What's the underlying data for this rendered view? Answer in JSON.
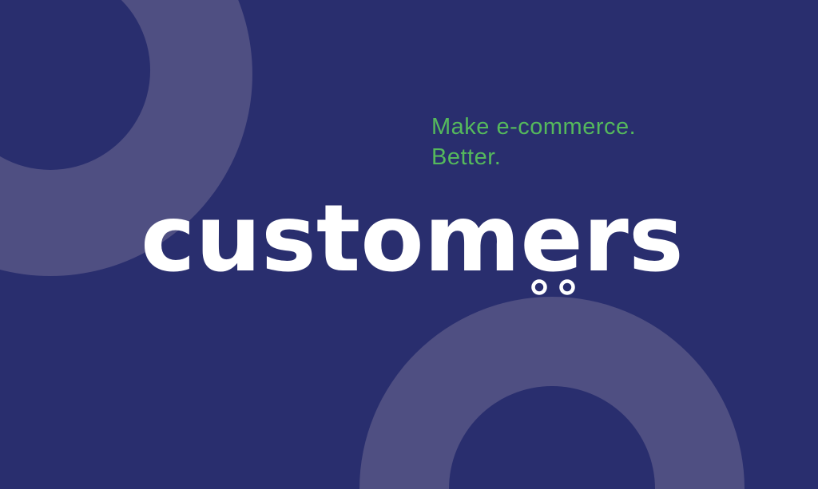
{
  "brand": {
    "wordmark": "customers",
    "tagline_line1": "Make e-commerce.",
    "tagline_line2": "Better."
  },
  "icons": {
    "wheels": "shopping-cart-wheels-icon"
  },
  "colors": {
    "background": "#292e6e",
    "ring": "#4f4f82",
    "accent_green": "#55b95c",
    "wordmark": "#ffffff"
  }
}
